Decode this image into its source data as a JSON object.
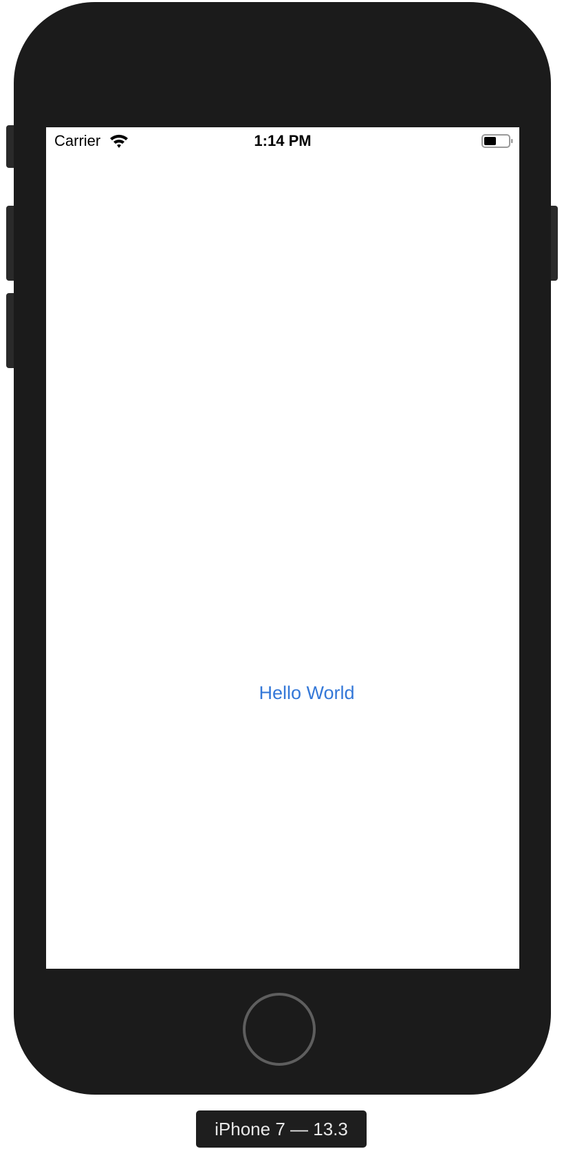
{
  "device": {
    "label": "iPhone 7 — 13.3",
    "frame_color": "#1b1b1b"
  },
  "status_bar": {
    "carrier": "Carrier",
    "time": "1:14 PM",
    "wifi_icon": "wifi-icon",
    "battery_icon": "battery-icon",
    "battery_level": 0.5
  },
  "app": {
    "hello_label": "Hello World",
    "accent_color": "#3478d8"
  }
}
